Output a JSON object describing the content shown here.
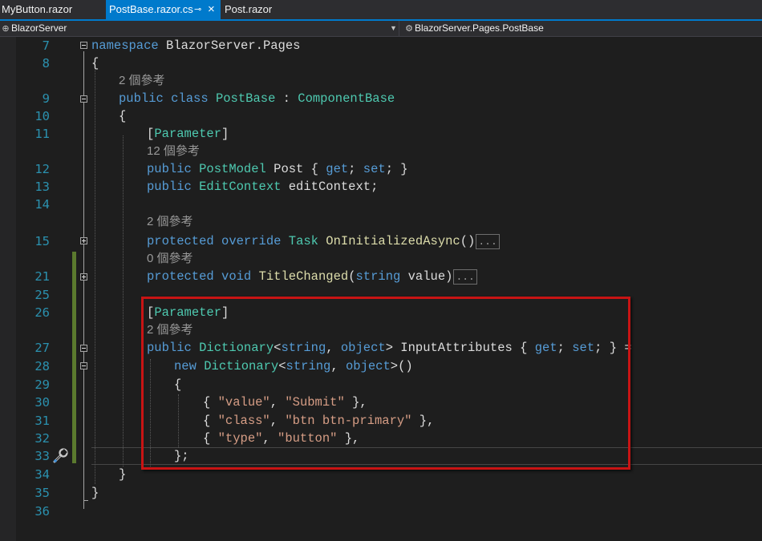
{
  "tabs": [
    {
      "label": "MyButton.razor"
    },
    {
      "label": "PostBase.razor.cs",
      "pin": "⊸",
      "close": "×"
    },
    {
      "label": "Post.razor"
    }
  ],
  "nav": {
    "project": "BlazorServer",
    "member": "BlazorServer.Pages.PostBase"
  },
  "lines": {
    "l7": {
      "num": "7",
      "ns_kw": "namespace",
      "ns_name": " BlazorServer.Pages"
    },
    "l8": {
      "num": "8",
      "text": "{"
    },
    "r1": {
      "text": "2 個參考"
    },
    "l9": {
      "num": "9",
      "kw1": "public",
      "kw2": "class",
      "cls": "PostBase",
      "colon": " : ",
      "base": "ComponentBase"
    },
    "l10": {
      "num": "10",
      "text": "{"
    },
    "l11": {
      "num": "11",
      "open": "[",
      "attr": "Parameter",
      "close": "]"
    },
    "r2": {
      "text": "12 個參考"
    },
    "l12": {
      "num": "12",
      "kw1": "public",
      "ty": "PostModel",
      "name": " Post { ",
      "get": "get",
      "semi1": "; ",
      "set": "set",
      "end": "; }"
    },
    "l13": {
      "num": "13",
      "kw1": "public",
      "ty": "EditContext",
      "name": " editContext;"
    },
    "l14": {
      "num": "14"
    },
    "r3": {
      "text": "2 個參考"
    },
    "l15": {
      "num": "15",
      "kw1": "protected",
      "kw2": "override",
      "ty": "Task",
      "method": "OnInitializedAsync",
      "paren": "()",
      "collapsed": "..."
    },
    "r4": {
      "text": "0 個參考"
    },
    "l21": {
      "num": "21",
      "kw1": "protected",
      "kw2": "void",
      "method": "TitleChanged",
      "open": "(",
      "kw3": "string",
      "param": " value",
      "close": ")",
      "collapsed": "..."
    },
    "l25": {
      "num": "25"
    },
    "l26": {
      "num": "26",
      "open": "[",
      "attr": "Parameter",
      "close": "]"
    },
    "r5": {
      "text": "2 個參考"
    },
    "l27": {
      "num": "27",
      "kw1": "public",
      "ty": "Dictionary",
      "lt": "<",
      "kw2": "string",
      "comma": ", ",
      "kw3": "object",
      "gt": "> ",
      "name": "InputAttributes",
      "brace": " { ",
      "get": "get",
      "semi1": "; ",
      "set": "set",
      "end": "; } ="
    },
    "l28": {
      "num": "28",
      "kw1": "new",
      "ty": "Dictionary",
      "lt": "<",
      "kw2": "string",
      "comma": ", ",
      "kw3": "object",
      "gt": ">()"
    },
    "l29": {
      "num": "29",
      "text": "{"
    },
    "l30": {
      "num": "30",
      "open": "{ ",
      "k": "\"value\"",
      "comma": ", ",
      "v": "\"Submit\"",
      "close": " },"
    },
    "l31": {
      "num": "31",
      "open": "{ ",
      "k": "\"class\"",
      "comma": ", ",
      "v": "\"btn btn-primary\"",
      "close": " },"
    },
    "l32": {
      "num": "32",
      "open": "{ ",
      "k": "\"type\"",
      "comma": ", ",
      "v": "\"button\"",
      "close": " },"
    },
    "l33": {
      "num": "33",
      "text": "};"
    },
    "l34": {
      "num": "34",
      "text": "}"
    },
    "l35": {
      "num": "35",
      "text": "}"
    },
    "l36": {
      "num": "36"
    }
  },
  "colors": {
    "keyword": "#569cd6",
    "type": "#4ec9b0",
    "string": "#d69d85",
    "method": "#dcdcaa",
    "line_number": "#2b91af",
    "highlight_border": "#c81414",
    "tab_active": "#007acc"
  }
}
